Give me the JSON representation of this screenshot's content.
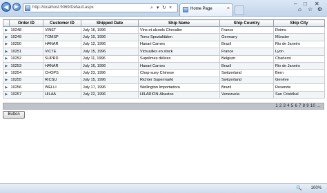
{
  "browser": {
    "url": "http://localhost:9069/Default.aspx",
    "tab_title": "Home Page",
    "nav_back_glyph": "◀",
    "nav_forward_glyph": "▶",
    "icons": {
      "back": "back-arrow-icon",
      "forward": "forward-arrow-icon",
      "search": "search-icon",
      "refresh": "refresh-icon",
      "stop": "stop-icon",
      "close_tab": "close-icon",
      "home": "home-icon",
      "favorites": "star-icon",
      "tools": "gear-icon"
    }
  },
  "grid": {
    "columns": [
      "Order ID",
      "Customer ID",
      "Shipped Date",
      "Ship Name",
      "Ship Country",
      "Ship City"
    ],
    "rows": [
      [
        "10248",
        "VINET",
        "July 16, 1996",
        "Vins et alcools Chevalier",
        "France",
        "Reims"
      ],
      [
        "10249",
        "TOMSP",
        "July 10, 1996",
        "Toms Spezialitäten",
        "Germany",
        "Münster"
      ],
      [
        "10250",
        "HANAR",
        "July 12, 1996",
        "Hanari Carnes",
        "Brazil",
        "Rio de Janeiro"
      ],
      [
        "10251",
        "VICTE",
        "July 15, 1996",
        "Victuailles en stock",
        "France",
        "Lyon"
      ],
      [
        "10252",
        "SUPRD",
        "July 11, 1996",
        "Suprêmes délices",
        "Belgium",
        "Charleroi"
      ],
      [
        "10253",
        "HANAR",
        "July 16, 1996",
        "Hanari Carnes",
        "Brazil",
        "Rio de Janeiro"
      ],
      [
        "10254",
        "CHOPS",
        "July 23, 1996",
        "Chop-suey Chinese",
        "Switzerland",
        "Bern"
      ],
      [
        "10255",
        "RICSU",
        "July 15, 1996",
        "Richter Supermarkt",
        "Switzerland",
        "Genève"
      ],
      [
        "10256",
        "WELLI",
        "July 17, 1996",
        "Wellington Importadora",
        "Brazil",
        "Resende"
      ],
      [
        "10257",
        "HILAA",
        "July 22, 1996",
        "HILARION-Abastos",
        "Venezuela",
        "San Cristóbal"
      ]
    ],
    "pager": "1 2 3 4 5 6 7 8 9 10 ..."
  },
  "button_label": "Button",
  "status": {
    "zoom": "100%"
  },
  "colors": {
    "chrome_top": "#dbe7f4",
    "grid_header": "#dfe4ea",
    "pager_bg": "#bfc3c8",
    "row_alt": "#f2f5f8"
  }
}
